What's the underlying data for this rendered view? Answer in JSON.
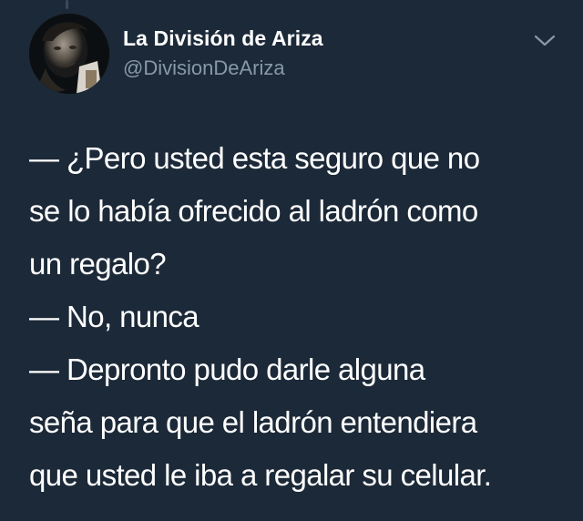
{
  "tweet": {
    "author": {
      "display_name": "La División de Ariza",
      "handle": "@DivisionDeAriza"
    },
    "menu_icon": "chevron-down-icon",
    "body_lines": [
      "— ¿Pero usted esta seguro que no",
      "se lo había ofrecido al ladrón como",
      "un regalo?",
      "— No, nunca",
      "— Depronto pudo darle alguna",
      "seña para que el ladrón entendiera",
      "que usted le iba a regalar su celular."
    ]
  },
  "colors": {
    "background": "#1c2938",
    "text_primary": "#ffffff",
    "text_secondary": "#8899a6"
  }
}
